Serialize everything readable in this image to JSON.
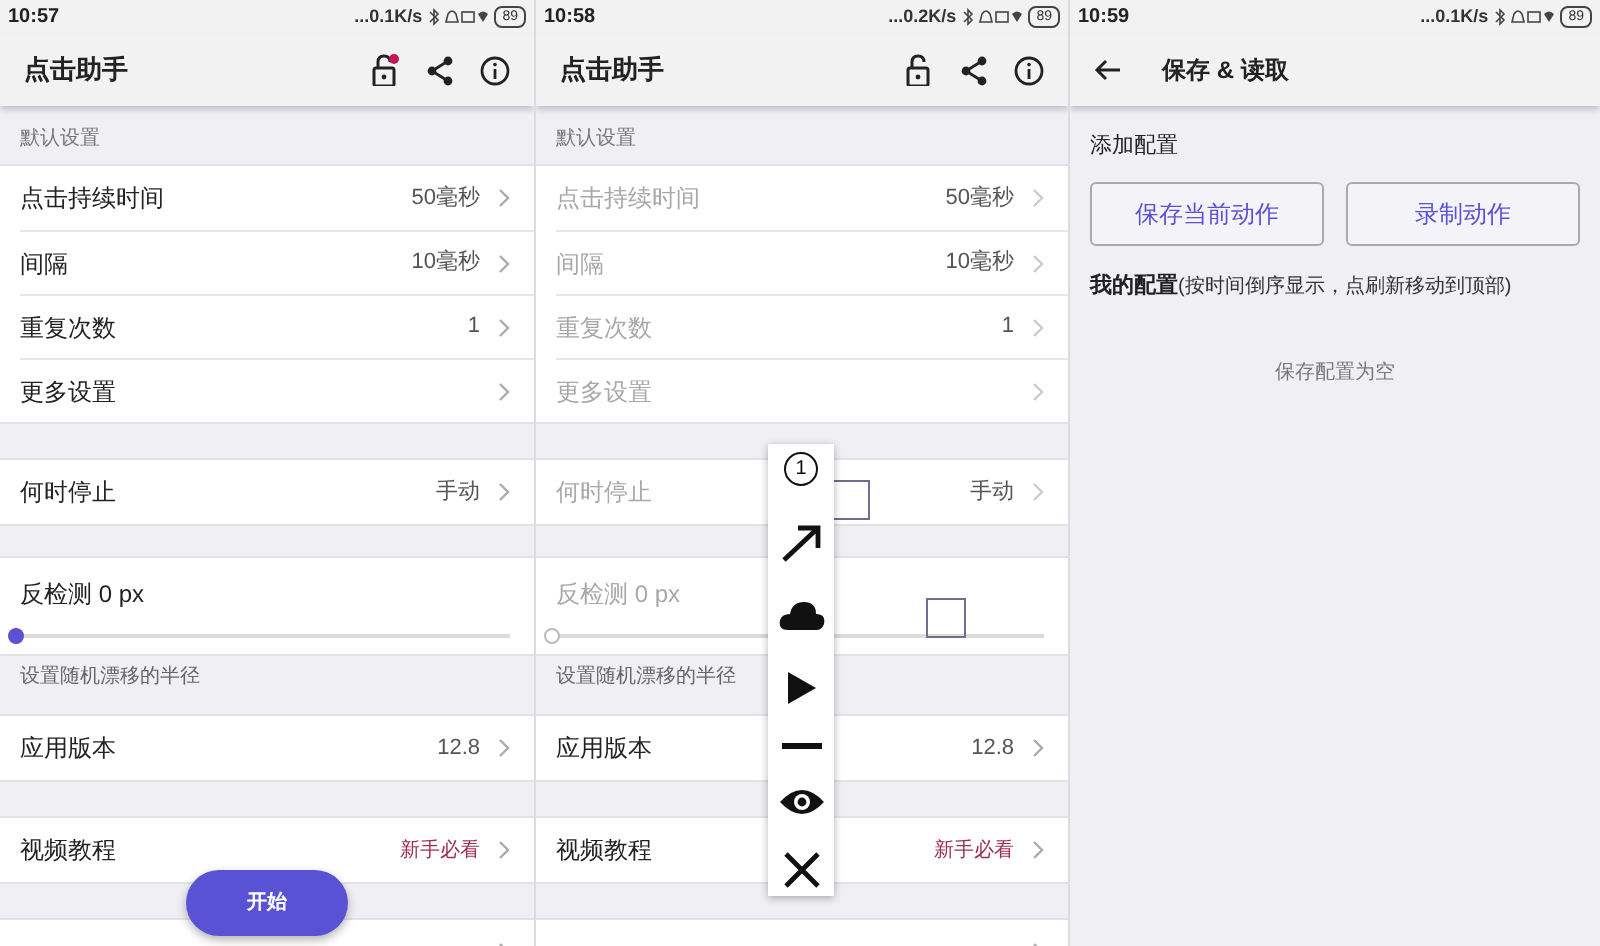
{
  "screens": [
    {
      "kind": "main",
      "status_bar": {
        "time": "10:57",
        "speed": "...0.1K/s",
        "battery": "89"
      },
      "app_bar": {
        "title": "点击助手",
        "lock_badge": true
      },
      "groups": [
        {
          "kind": "rows",
          "header": "默认设置",
          "rows": [
            {
              "label": "点击持续时间",
              "value": "50毫秒",
              "disabled": false
            },
            {
              "label": "间隔",
              "value": "10毫秒",
              "disabled": false
            },
            {
              "label": "重复次数",
              "value": "1",
              "disabled": false
            },
            {
              "label": "更多设置",
              "disabled": false
            }
          ]
        },
        {
          "kind": "rows",
          "rows": [
            {
              "label": "何时停止",
              "value": "手动",
              "disabled": false
            }
          ]
        },
        {
          "kind": "slider",
          "label": "反检测 0 px",
          "level": 0,
          "disabled": false,
          "hint": "设置随机漂移的半径"
        },
        {
          "kind": "rows",
          "rows": [
            {
              "label": "应用版本",
              "value": "12.8",
              "disabled": false
            }
          ]
        },
        {
          "kind": "rows",
          "rows": [
            {
              "label": "视频教程",
              "value": "新手必看",
              "accent": true,
              "disabled": false
            }
          ]
        },
        {
          "kind": "rows",
          "rows": [
            {}
          ]
        }
      ],
      "start_button": "开始"
    },
    {
      "kind": "main",
      "status_bar": {
        "time": "10:58",
        "speed": "...0.2K/s",
        "battery": "89"
      },
      "app_bar": {
        "title": "点击助手",
        "lock_badge": false
      },
      "groups": [
        {
          "kind": "rows",
          "header": "默认设置",
          "rows": [
            {
              "label": "点击持续时间",
              "value": "50毫秒",
              "disabled": true
            },
            {
              "label": "间隔",
              "value": "10毫秒",
              "disabled": true
            },
            {
              "label": "重复次数",
              "value": "1",
              "disabled": true
            },
            {
              "label": "更多设置",
              "disabled": true
            }
          ]
        },
        {
          "kind": "rows",
          "rows": [
            {
              "label": "何时停止",
              "value": "手动",
              "disabled": true
            }
          ]
        },
        {
          "kind": "slider",
          "label": "反检测 0 px",
          "level": 0,
          "disabled": true,
          "hint": "设置随机漂移的半径"
        },
        {
          "kind": "rows",
          "rows": [
            {
              "label": "应用版本",
              "value": "12.8",
              "disabled": false
            }
          ]
        },
        {
          "kind": "rows",
          "rows": [
            {
              "label": "视频教程",
              "value": "新手必看",
              "accent": true,
              "disabled": false
            }
          ]
        },
        {
          "kind": "rows",
          "rows": [
            {}
          ]
        }
      ],
      "floating_toolbar": {
        "counter": "1"
      }
    },
    {
      "kind": "saves",
      "status_bar": {
        "time": "10:59",
        "speed": "...0.1K/s",
        "battery": "89"
      },
      "app_bar": {
        "title": "保存 & 读取"
      },
      "add_label": "添加配置",
      "buttons": [
        "保存当前动作",
        "录制动作"
      ],
      "list_title": "我的配置",
      "list_hint": "(按时间倒序显示，点刷新移动到顶部)",
      "empty_text": "保存配置为空"
    }
  ]
}
